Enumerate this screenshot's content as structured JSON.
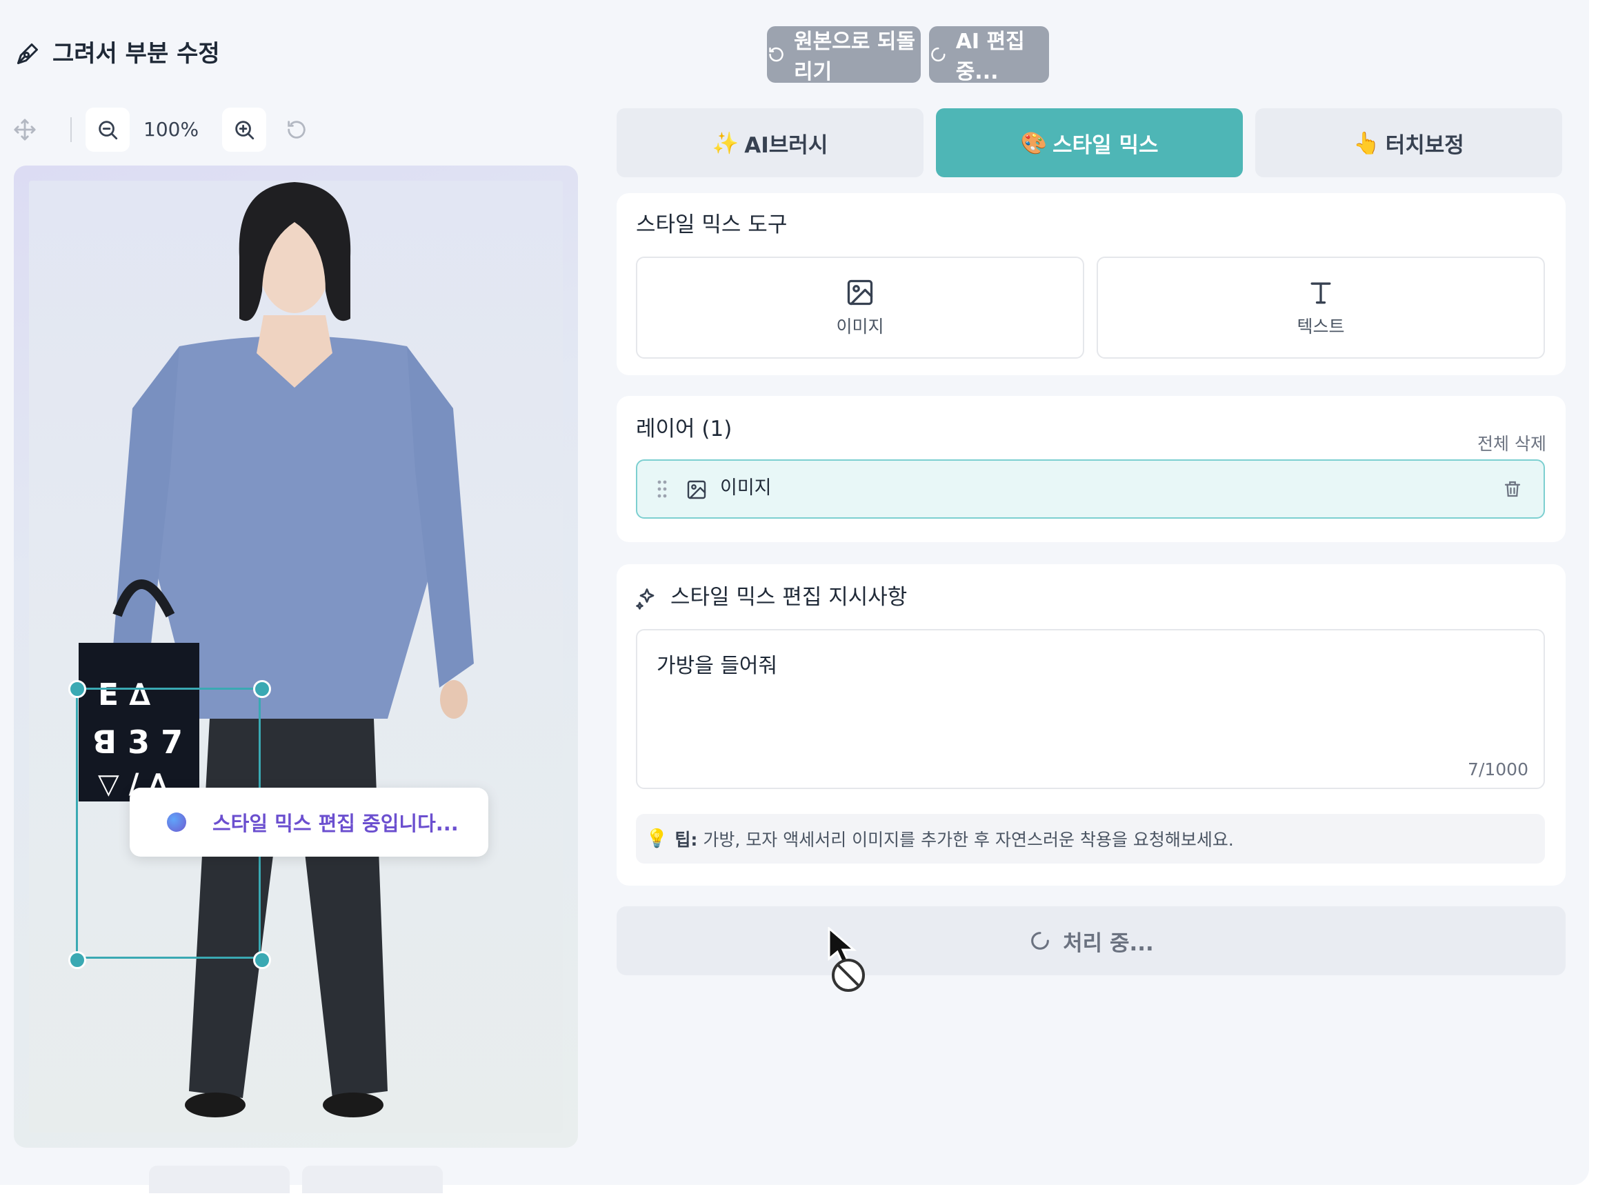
{
  "header": {
    "title": "그려서 부분 수정",
    "revert_button": "원본으로 되돌리기",
    "ai_edit_button": "AI 편집 중..."
  },
  "zoom": {
    "level": "100%"
  },
  "canvas": {
    "toast_text": "스타일 믹스 편집 중입니다..."
  },
  "tabs": [
    {
      "label": "AI브러시",
      "emoji": "✨",
      "active": false
    },
    {
      "label": "스타일 믹스",
      "emoji": "🎨",
      "active": true
    },
    {
      "label": "터치보정",
      "emoji": "👆",
      "active": false
    }
  ],
  "tools_card": {
    "title": "스타일 믹스 도구",
    "image_label": "이미지",
    "text_label": "텍스트"
  },
  "layers_card": {
    "title": "레이어 (1)",
    "delete_all": "전체 삭제",
    "items": [
      {
        "label": "이미지"
      }
    ]
  },
  "prompt_card": {
    "title": "스타일 믹스 편집 지시사항",
    "value": "가방을 들어줘",
    "counter": "7/1000",
    "tip_label": "팁:",
    "tip_text": "가방, 모자 액세서리 이미지를 추가한 후 자연스러운 착용을 요청해보세요."
  },
  "process_button": "처리 중...",
  "colors": {
    "accent": "#4eb6b6",
    "disabled": "#9ca3af",
    "toast_text": "#6b4fcf"
  }
}
